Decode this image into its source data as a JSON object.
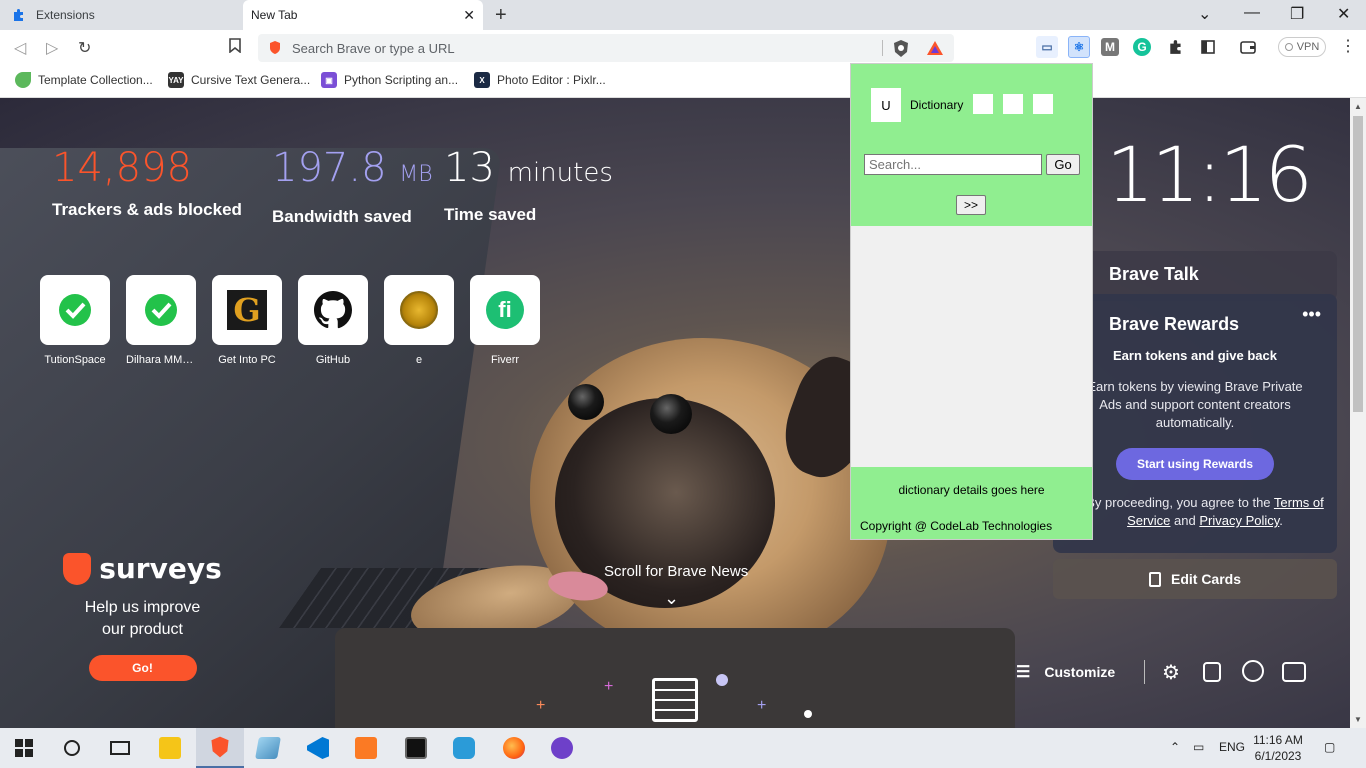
{
  "browser": {
    "tabs": [
      {
        "label": "Extensions"
      },
      {
        "label": "New Tab"
      }
    ],
    "omnibox_placeholder": "Search Brave or type a URL",
    "vpn_label": "VPN",
    "bookmarks": [
      {
        "label": "Template Collection..."
      },
      {
        "label": "Cursive Text Genera..."
      },
      {
        "label": "Python Scripting an..."
      },
      {
        "label": "Photo Editor : Pixlr..."
      }
    ]
  },
  "stats": {
    "trackers": {
      "value": "14,898",
      "label": "Trackers & ads blocked",
      "color": "#fb542b"
    },
    "bandwidth": {
      "value": "197.8",
      "unit": "MB",
      "label": "Bandwidth saved",
      "color": "#a3a0f0"
    },
    "time": {
      "value": "13",
      "unit": "minutes",
      "label": "Time saved",
      "color": "#ffffff"
    }
  },
  "top_sites": [
    {
      "label": "TutionSpace"
    },
    {
      "label": "Dilhara MMS..."
    },
    {
      "label": "Get Into PC"
    },
    {
      "label": "GitHub"
    },
    {
      "label": "e"
    },
    {
      "label": "Fiverr"
    }
  ],
  "clock": "11:16",
  "cards": {
    "talk_title": "Brave Talk",
    "rewards_title": "Brave Rewards",
    "rewards_more": "•••",
    "rewards_sub": "Earn tokens and give back",
    "rewards_desc": "Earn tokens by viewing Brave Private Ads and support content creators automatically.",
    "rewards_button": "Start using Rewards",
    "terms_prefix": "By proceeding, you agree to the ",
    "terms_link": "Terms of Service",
    "terms_and": " and ",
    "privacy_link": "Privacy Policy",
    "terms_suffix": ".",
    "edit_cards": "Edit Cards"
  },
  "surveys": {
    "title": "surveys",
    "text_line1": "Help us improve",
    "text_line2": "our product",
    "button": "Go!"
  },
  "news": {
    "scroll_label": "Scroll for Brave News"
  },
  "bottom_bar": {
    "customize": "Customize"
  },
  "popup": {
    "logo_letter": "U",
    "title": "Dictionary",
    "search_placeholder": "Search...",
    "go_button": "Go",
    "next_button": ">>",
    "details_text": "dictionary details goes here",
    "copyright": "Copyright @ CodeLab Technologies",
    "bg_color": "#90ee90"
  },
  "taskbar": {
    "language": "ENG",
    "time": "11:16 AM",
    "date": "6/1/2023"
  }
}
